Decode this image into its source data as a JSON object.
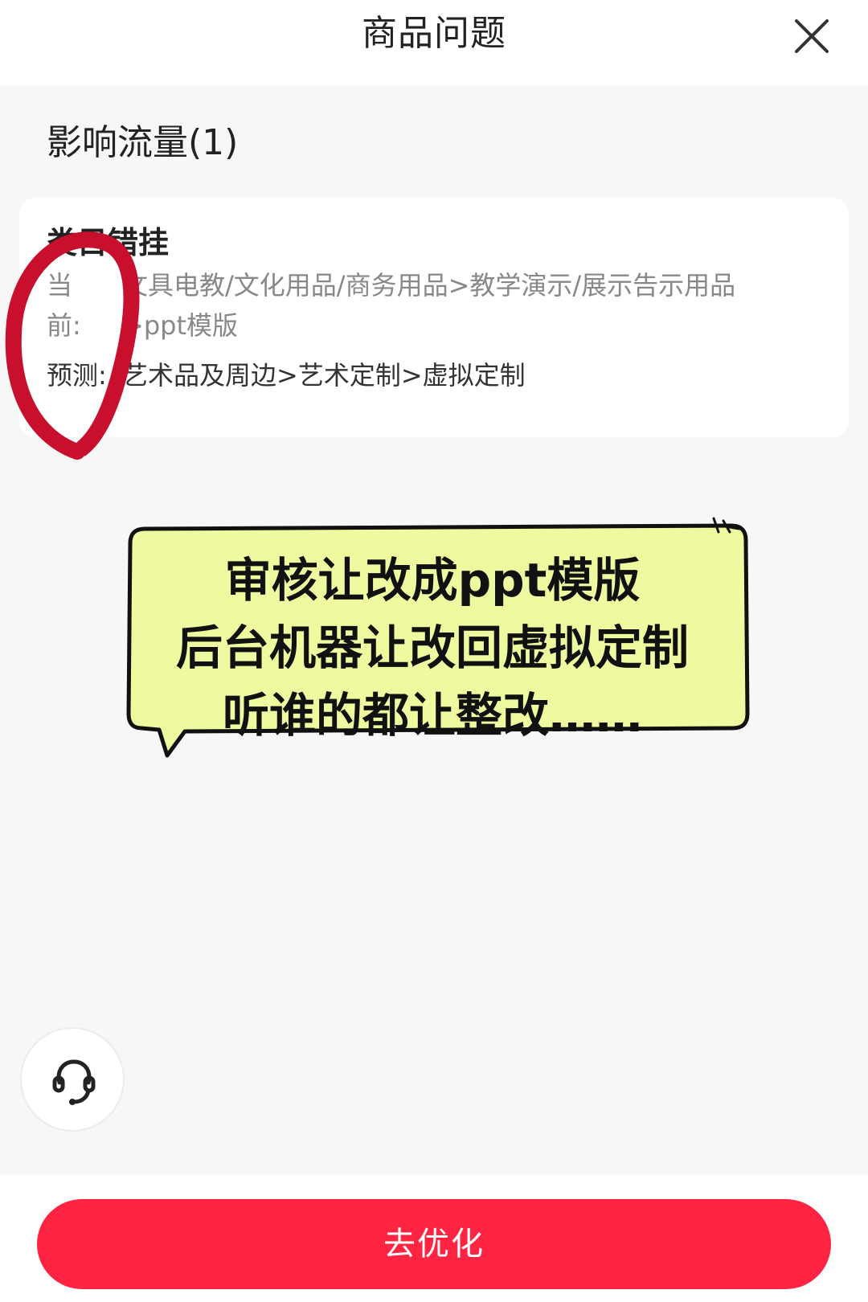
{
  "header": {
    "title": "商品问题",
    "close_icon": "close-icon"
  },
  "section": {
    "title": "影响流量(1)"
  },
  "issue_card": {
    "title": "类目错挂",
    "current_label_line1": "当",
    "current_label_line2": "前:",
    "current_value_line1": "文具电教/文化用品/商务用品>教学演示/展示告示用品",
    "current_value_line2": ">ppt模版",
    "predict_label": "预测:",
    "predict_value": "艺术品及周边>艺术定制>虚拟定制"
  },
  "annotation": {
    "line1": "审核让改成ppt模版",
    "line2": "后台机器让改回虚拟定制",
    "line3": "听谁的都让整改……",
    "circle_color": "#c8102e",
    "bubble_color": "#eef9a0"
  },
  "support": {
    "icon": "headset-icon"
  },
  "footer": {
    "button_label": "去优化",
    "accent_color": "#ff2442"
  }
}
